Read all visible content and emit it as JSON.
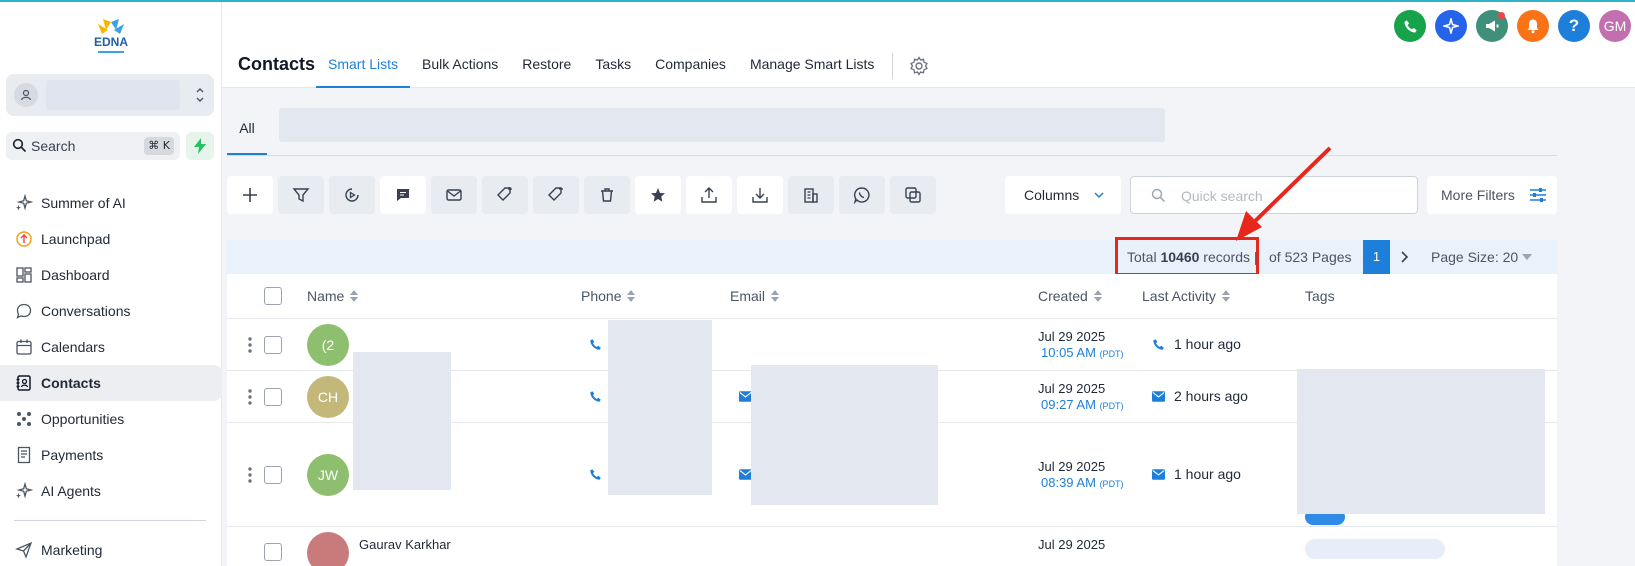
{
  "brand": {
    "logo_text": "EDNA"
  },
  "sidebar": {
    "search_label": "Search",
    "search_shortcut": "⌘ K",
    "items": [
      {
        "label": "Summer of AI",
        "icon": "sparkle-icon"
      },
      {
        "label": "Launchpad",
        "icon": "launchpad-icon"
      },
      {
        "label": "Dashboard",
        "icon": "dashboard-icon"
      },
      {
        "label": "Conversations",
        "icon": "chat-bubble-icon"
      },
      {
        "label": "Calendars",
        "icon": "calendar-icon"
      },
      {
        "label": "Contacts",
        "icon": "contacts-book-icon",
        "active": true
      },
      {
        "label": "Opportunities",
        "icon": "pipeline-icon"
      },
      {
        "label": "Payments",
        "icon": "receipt-icon"
      },
      {
        "label": "AI Agents",
        "icon": "sparkle-icon"
      },
      {
        "label": "Marketing",
        "icon": "send-icon"
      }
    ]
  },
  "header": {
    "title": "Contacts",
    "tabs": [
      {
        "label": "Smart Lists",
        "active": true
      },
      {
        "label": "Bulk Actions"
      },
      {
        "label": "Restore"
      },
      {
        "label": "Tasks"
      },
      {
        "label": "Companies"
      },
      {
        "label": "Manage Smart Lists"
      }
    ],
    "top_icons": [
      {
        "name": "phone-icon",
        "color": "#16a34a"
      },
      {
        "name": "ai-sparkle-icon",
        "color": "#2563eb"
      },
      {
        "name": "megaphone-icon",
        "color": "#3f8f7a"
      },
      {
        "name": "bell-icon",
        "color": "#f97316"
      },
      {
        "name": "help-icon",
        "color": "#1d7fd9"
      },
      {
        "name": "user-avatar",
        "color": "#c26fb0",
        "text": "GM"
      }
    ]
  },
  "smart_list": {
    "all_label": "All"
  },
  "toolbar": {
    "columns_label": "Columns",
    "quick_search_placeholder": "Quick search",
    "more_filters_label": "More Filters"
  },
  "pagination": {
    "total_prefix": "Total ",
    "total_count": "10460",
    "total_suffix": " records |",
    "pages_text": "of 523 Pages",
    "current_page": "1",
    "page_size_text": "Page Size: 20"
  },
  "table": {
    "columns": [
      "Name",
      "Phone",
      "Email",
      "Created",
      "Last Activity",
      "Tags"
    ],
    "rows": [
      {
        "initials": "(2",
        "avatar_color": "#8dbf6f",
        "created_date": "Jul 29 2025",
        "created_time": "10:05 AM",
        "tz": "(PDT)",
        "activity": "1 hour ago",
        "activity_icon": "phone-icon"
      },
      {
        "initials": "CH",
        "avatar_color": "#c3b77a",
        "created_date": "Jul 29 2025",
        "created_time": "09:27 AM",
        "tz": "(PDT)",
        "activity": "2 hours ago",
        "activity_icon": "mail-icon"
      },
      {
        "initials": "JW",
        "avatar_color": "#8dbf6f",
        "created_date": "Jul 29 2025",
        "created_time": "08:39 AM",
        "tz": "(PDT)",
        "activity": "1 hour ago",
        "activity_icon": "mail-icon"
      },
      {
        "initials": "",
        "avatar_color": "#c97a7a",
        "name": "Gaurav Karkhar",
        "created_date": "Jul 29 2025"
      }
    ]
  }
}
